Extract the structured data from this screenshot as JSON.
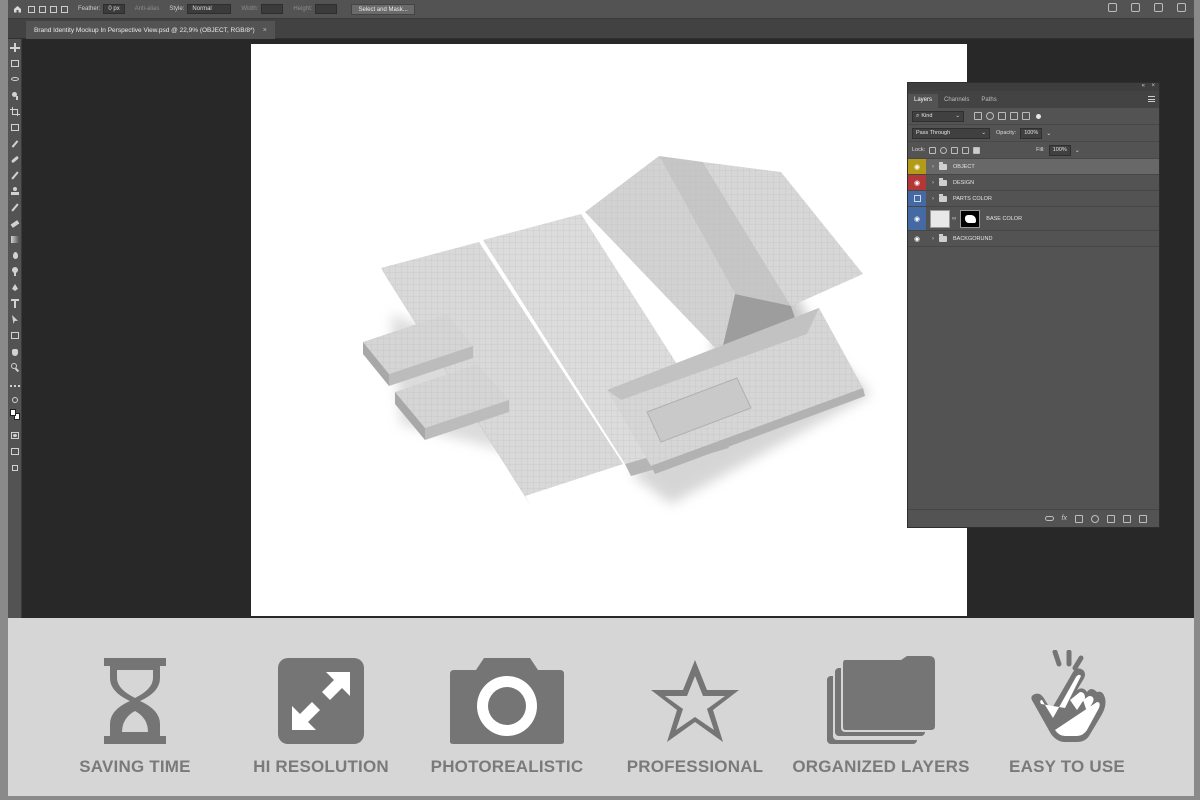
{
  "app": {
    "document_tab": "Brand Identity Mockup In Perspective View.psd @ 22,9% (OBJECT, RGB/8*)",
    "close_glyph": "×"
  },
  "optbar": {
    "feather_label": "Feather:",
    "feather_value": "0 px",
    "antialias_label": "Anti-alias",
    "style_label": "Style:",
    "style_value": "Normal",
    "width_label": "Width:",
    "height_label": "Height:",
    "select_mask_label": "Select and Mask..."
  },
  "layers_panel": {
    "tabs": [
      "Layers",
      "Channels",
      "Paths"
    ],
    "kind_label": "Kind",
    "blend_mode": "Pass Through",
    "opacity_label": "Opacity:",
    "opacity_value": "100%",
    "lock_label": "Lock:",
    "fill_label": "Fill:",
    "fill_value": "100%",
    "layers": [
      {
        "name": "OBJECT",
        "tag_color": "#b39b17",
        "type": "group",
        "selected": true
      },
      {
        "name": "DESIGN",
        "tag_color": "#b43636",
        "type": "group",
        "selected": false
      },
      {
        "name": "PARTS COLOR",
        "tag_color": "#4569a2",
        "type": "group",
        "selected": false
      },
      {
        "name": "BASE COLOR",
        "tag_color": "#4569a2",
        "type": "layer",
        "selected": false
      },
      {
        "name": "BACKGORUND",
        "tag_color": "none",
        "type": "group",
        "selected": false
      }
    ]
  },
  "features": [
    {
      "label": "SAVING TIME",
      "icon": "hourglass-icon"
    },
    {
      "label": "HI RESOLUTION",
      "icon": "expand-arrows-icon"
    },
    {
      "label": "PHOTOREALISTIC",
      "icon": "camera-icon"
    },
    {
      "label": "PROFESSIONAL",
      "icon": "star-icon"
    },
    {
      "label": "ORGANIZED LAYERS",
      "icon": "stacked-layers-icon"
    },
    {
      "label": "EASY TO USE",
      "icon": "tap-hand-icon"
    }
  ],
  "colors": {
    "icon_gray": "#757575",
    "strip_bg": "#d6d6d6",
    "workspace_bg": "#282828"
  }
}
